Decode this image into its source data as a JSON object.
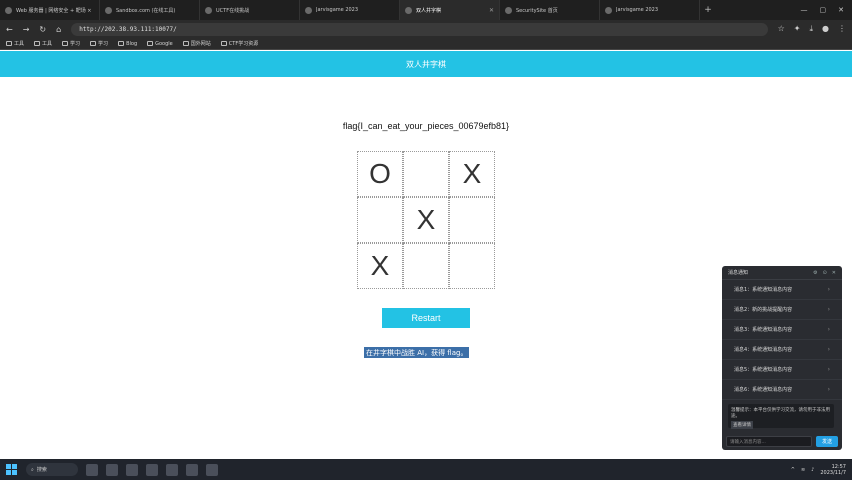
{
  "browser": {
    "tabs": [
      {
        "title": "Web 服务器 | 网络安全 + 靶场 ×",
        "active": false
      },
      {
        "title": "Sandbox.com (在线工具)",
        "active": false
      },
      {
        "title": "UCTF在线挑战",
        "active": false
      },
      {
        "title": "Jarvisgame 2023",
        "active": false
      },
      {
        "title": "双人井字棋",
        "active": true
      },
      {
        "title": "SecuritySite 首页",
        "active": false
      },
      {
        "title": "Jarvisgame 2023",
        "active": false
      }
    ],
    "new_tab": "+",
    "window_controls": [
      "—",
      "▢",
      "✕"
    ],
    "url": "http://202.38.93.111:10077/",
    "bookmarks": [
      "工具",
      "工具",
      "学习",
      "学习",
      "Blog",
      "Google",
      "国外网站",
      "CTF学习资源"
    ]
  },
  "page": {
    "header_title": "双人井字棋",
    "flag_text": "flag{I_can_eat_your_pieces_00679efb81}",
    "board": [
      "O",
      "",
      "X",
      "",
      "X",
      "",
      "X",
      "",
      ""
    ],
    "restart_label": "Restart",
    "hint_text": "在井字棋中战胜 AI，获得 flag。"
  },
  "side_panel": {
    "title": "消息通知",
    "items": [
      "消息1：系统通知消息内容",
      "消息2：新的挑战提醒内容",
      "消息3：系统通知消息内容",
      "消息4：系统通知消息内容",
      "消息5：系统通知消息内容",
      "消息6：系统通知消息内容"
    ],
    "note_text": "温馨提示：本平台仅供学习交流，请勿用于非法用途。",
    "note_tag": "查看详情",
    "input_placeholder": "请输入消息内容...",
    "send_label": "发送"
  },
  "taskbar": {
    "search_label": "搜索",
    "time": "12:57",
    "date": "2023/11/7"
  },
  "colors": {
    "accent": "#23c2e4",
    "hint_bg": "#3c6fa8"
  }
}
